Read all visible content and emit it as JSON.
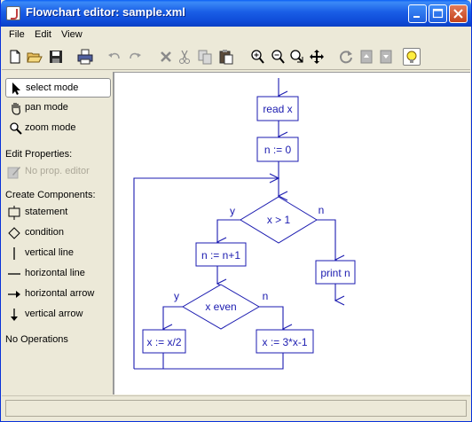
{
  "window": {
    "title": "Flowchart editor: sample.xml"
  },
  "menu": [
    "File",
    "Edit",
    "View"
  ],
  "toolbar": {
    "icons": [
      "new-file-icon",
      "open-folder-icon",
      "save-icon",
      "print-icon",
      "undo-icon",
      "redo-icon",
      "delete-icon",
      "cut-icon",
      "copy-icon",
      "paste-icon",
      "zoom-in-icon",
      "zoom-out-icon",
      "zoom-fit-icon",
      "move-icon",
      "refresh-icon",
      "move-to-back-icon",
      "move-to-front-icon",
      "hint-bulb-icon"
    ]
  },
  "modes": {
    "select": "select mode",
    "pan": "pan mode",
    "zoom": "zoom mode"
  },
  "edit_properties": {
    "title": "Edit Properties:",
    "editor": "No prop. editor"
  },
  "components": {
    "title": "Create Components:",
    "items": [
      "statement",
      "condition",
      "vertical line",
      "horizontal line",
      "horizontal arrow",
      "vertical arrow"
    ]
  },
  "operations": "No Operations",
  "flowchart": {
    "nodes": {
      "read": "read x",
      "init": "n := 0",
      "cond1": "x > 1",
      "incr": "n := n+1",
      "print": "print n",
      "cond2": "x even",
      "half": "x := x/2",
      "triple": "x := 3*x-1"
    },
    "labels": {
      "y1": "y",
      "n1": "n",
      "y2": "y",
      "n2": "n"
    }
  },
  "status": "",
  "colors": {
    "flow": "#1b1bb0",
    "titlebar": "#0a5ff5",
    "panel": "#ece9d8"
  }
}
